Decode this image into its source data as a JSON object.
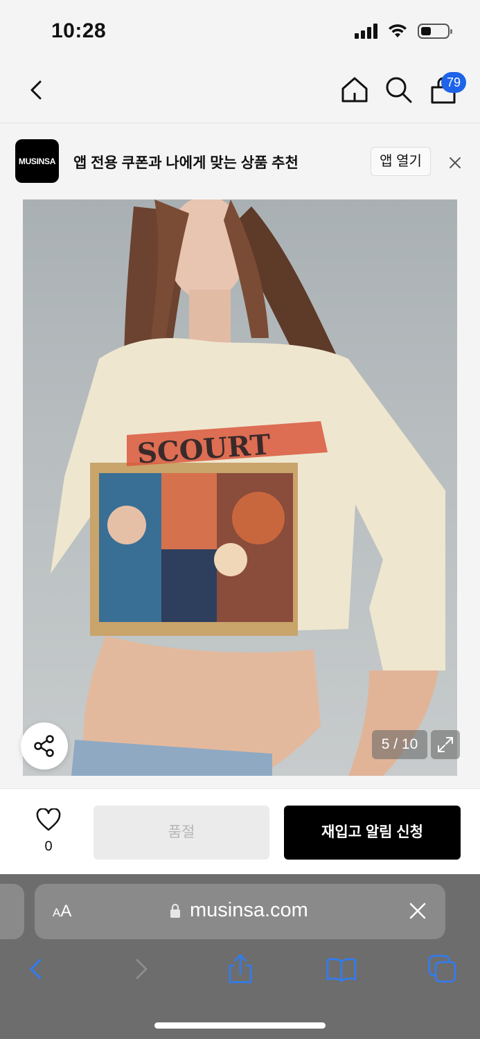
{
  "status_bar": {
    "time": "10:28"
  },
  "nav": {
    "cart_count": "79"
  },
  "app_banner": {
    "logo_text": "MUSINSA",
    "text": "앱 전용 쿠폰과 나에게 맞는 상품 추천",
    "open_label": "앱 열기"
  },
  "gallery": {
    "counter": "5 / 10"
  },
  "actions": {
    "like_count": "0",
    "soldout_label": "품절",
    "restock_label": "재입고 알림 신청"
  },
  "browser": {
    "aa_label_big": "A",
    "aa_label_small": "A",
    "url": "musinsa.com"
  },
  "colors": {
    "accent_badge": "#1e63e9",
    "primary_button": "#000000",
    "disabled_button": "#ebebeb",
    "toolbar_icon_active": "#2f7cf6"
  }
}
